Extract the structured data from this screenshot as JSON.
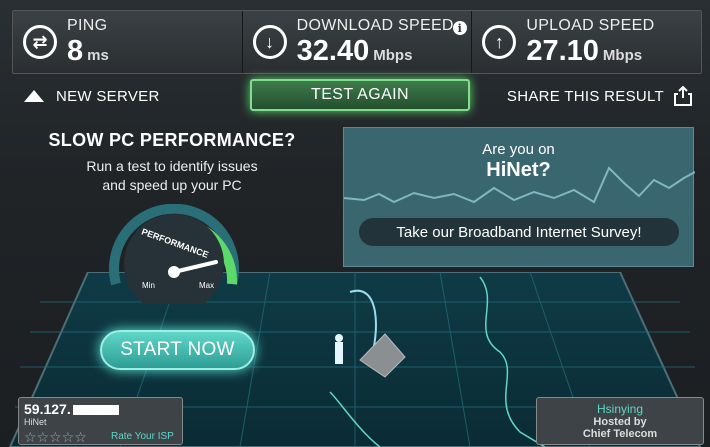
{
  "metrics": {
    "ping": {
      "label": "PING",
      "value": "8",
      "unit": "ms"
    },
    "download": {
      "label": "DOWNLOAD SPEED",
      "value": "32.40",
      "unit": "Mbps"
    },
    "upload": {
      "label": "UPLOAD SPEED",
      "value": "27.10",
      "unit": "Mbps"
    }
  },
  "actions": {
    "new_server": "NEW SERVER",
    "test_again": "TEST AGAIN",
    "share": "SHARE THIS RESULT"
  },
  "promo": {
    "title": "SLOW PC PERFORMANCE?",
    "line1": "Run a test to identify issues",
    "line2": "and speed up your PC",
    "gauge_label": "PERFORMANCE",
    "gauge_min": "Min",
    "gauge_max": "Max",
    "start": "START NOW"
  },
  "ad": {
    "question": "Are you on",
    "isp": "HiNet?",
    "survey": "Take our Broadband Internet Survey!"
  },
  "client": {
    "ip": "59.127.",
    "isp": "HiNet",
    "rate_label": "Rate Your ISP",
    "stars": "☆☆☆☆☆"
  },
  "server": {
    "city": "Hsinying",
    "hosted_by": "Hosted by",
    "host": "Chief Telecom"
  },
  "colors": {
    "accent": "#5fd6c8",
    "green": "#5dd86b",
    "ad_bg": "#3a6670"
  }
}
